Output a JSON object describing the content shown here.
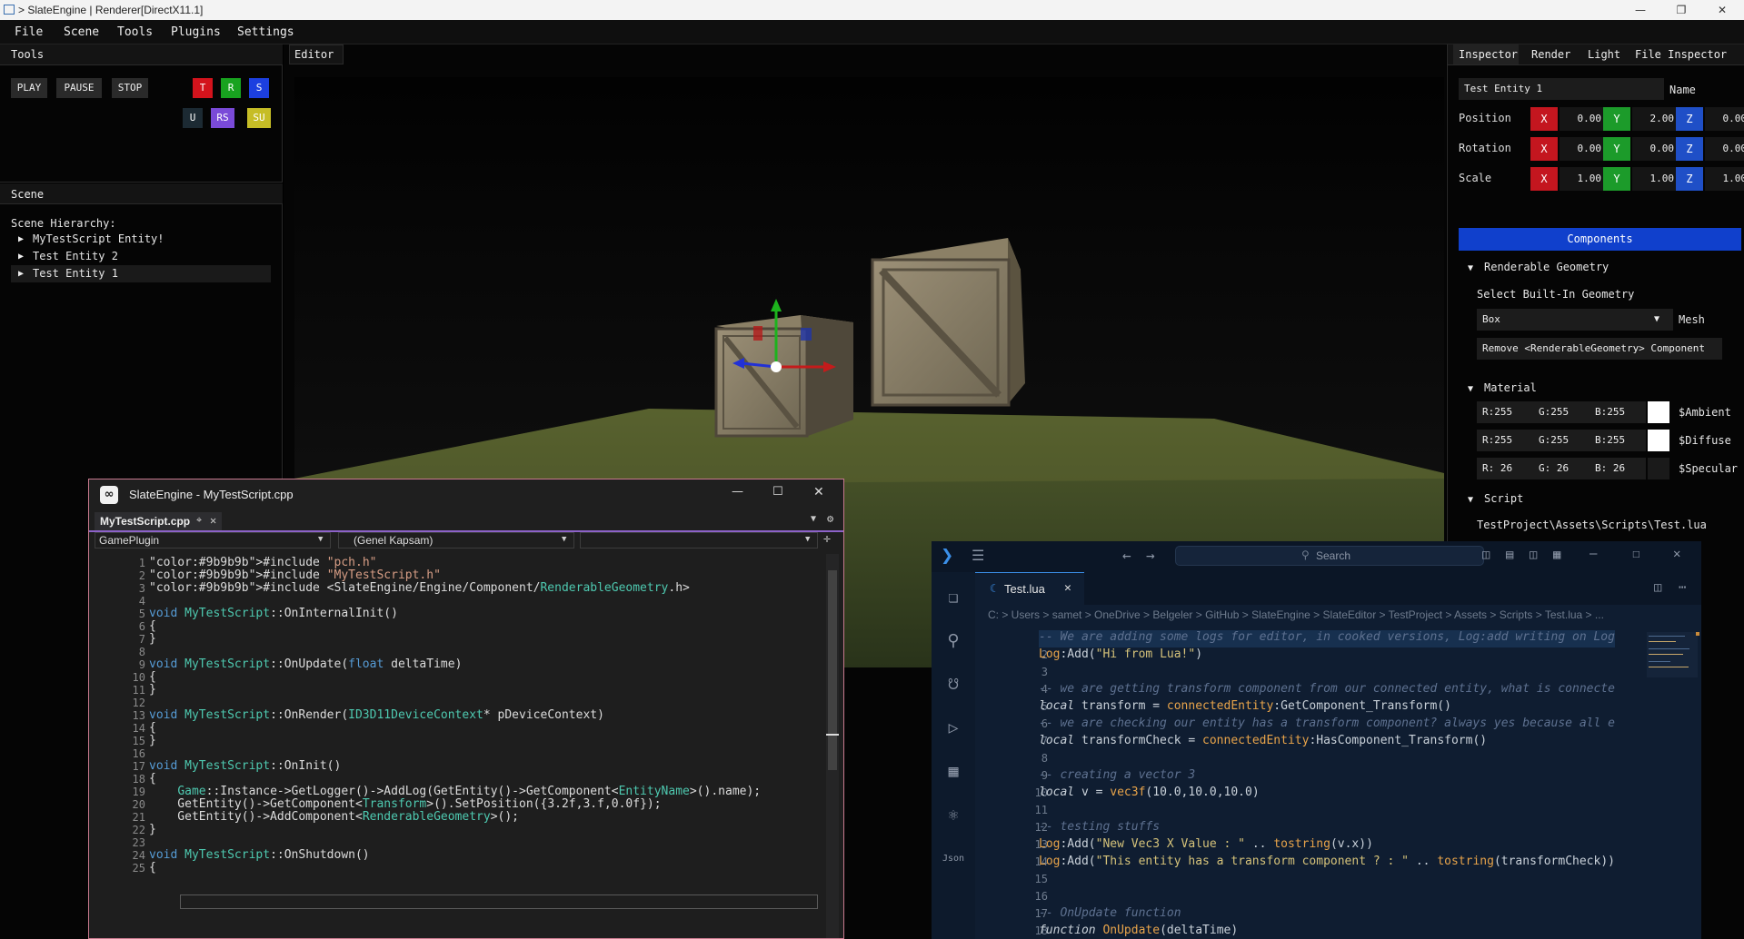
{
  "window": {
    "title": "> SlateEngine | Renderer[DirectX11.1]"
  },
  "menu": [
    "File",
    "Scene",
    "Tools",
    "Plugins",
    "Settings"
  ],
  "tools_panel": {
    "title": "Tools",
    "play": "PLAY",
    "pause": "PAUSE",
    "stop": "STOP",
    "gizmo_buttons": [
      {
        "label": "T",
        "color": "#d3131c"
      },
      {
        "label": "R",
        "color": "#18a31f"
      },
      {
        "label": "S",
        "color": "#1c3fe0"
      },
      {
        "label": "U",
        "color": "#1c2a33"
      },
      {
        "label": "RS",
        "color": "#7a4ad8"
      },
      {
        "label": "SU",
        "color": "#c6bd26"
      }
    ]
  },
  "scene_panel": {
    "title": "Scene",
    "hierarchy_label": "Scene Hierarchy:",
    "items": [
      "MyTestScript Entity!",
      "Test Entity 2",
      "Test Entity 1"
    ]
  },
  "editor": {
    "tab": "Editor"
  },
  "inspector": {
    "tabs": [
      "Inspector",
      "Render",
      "Light",
      "File Inspector"
    ],
    "entity_name": "Test Entity 1",
    "name_label": "Name",
    "transform": [
      {
        "label": "Position",
        "x": "0.00",
        "y": "2.00",
        "z": "0.00"
      },
      {
        "label": "Rotation",
        "x": "0.00",
        "y": "0.00",
        "z": "0.00"
      },
      {
        "label": "Scale",
        "x": "1.00",
        "y": "1.00",
        "z": "1.00"
      }
    ],
    "axis_labels": {
      "x": "X",
      "y": "Y",
      "z": "Z"
    },
    "components_button": "Components",
    "renderable": {
      "header": "Renderable Geometry",
      "select_label": "Select Built-In Geometry",
      "geometry_value": "Box",
      "mesh_label": "Mesh",
      "remove_button": "Remove <RenderableGeometry> Component"
    },
    "material": {
      "header": "Material",
      "rows": [
        {
          "r": "R:255",
          "g": "G:255",
          "b": "B:255",
          "swatch": "#ffffff",
          "label": "$Ambient"
        },
        {
          "r": "R:255",
          "g": "G:255",
          "b": "B:255",
          "swatch": "#ffffff",
          "label": "$Diffuse"
        },
        {
          "r": "R: 26",
          "g": "G: 26",
          "b": "B: 26",
          "swatch": "#1a1a1a",
          "label": "$Specular"
        }
      ]
    },
    "script": {
      "header": "Script",
      "path": "TestProject\\Assets\\Scripts\\Test.lua"
    }
  },
  "vs": {
    "title": "SlateEngine - MyTestScript.cpp",
    "file_tab": "MyTestScript.cpp",
    "project_dropdown": "GamePlugin",
    "scope_dropdown": "(Genel Kapsam)",
    "lines": [
      {
        "n": "1",
        "t": "#include \"pch.h\""
      },
      {
        "n": "2",
        "t": "#include \"MyTestScript.h\""
      },
      {
        "n": "3",
        "t": "#include <SlateEngine/Engine/Component/RenderableGeometry.h>"
      },
      {
        "n": "4",
        "t": ""
      },
      {
        "n": "5",
        "t": "void MyTestScript::OnInternalInit()"
      },
      {
        "n": "6",
        "t": "{"
      },
      {
        "n": "7",
        "t": "}"
      },
      {
        "n": "8",
        "t": ""
      },
      {
        "n": "9",
        "t": "void MyTestScript::OnUpdate(float deltaTime)"
      },
      {
        "n": "10",
        "t": "{"
      },
      {
        "n": "11",
        "t": "}"
      },
      {
        "n": "12",
        "t": ""
      },
      {
        "n": "13",
        "t": "void MyTestScript::OnRender(ID3D11DeviceContext* pDeviceContext)"
      },
      {
        "n": "14",
        "t": "{"
      },
      {
        "n": "15",
        "t": "}"
      },
      {
        "n": "16",
        "t": ""
      },
      {
        "n": "17",
        "t": "void MyTestScript::OnInit()"
      },
      {
        "n": "18",
        "t": "{"
      },
      {
        "n": "19",
        "t": "    Game::Instance->GetLogger()->AddLog(GetEntity()->GetComponent<EntityName>().name);"
      },
      {
        "n": "20",
        "t": "    GetEntity()->GetComponent<Transform>().SetPosition({3.2f,3.f,0.0f});"
      },
      {
        "n": "21",
        "t": "    GetEntity()->AddComponent<RenderableGeometry>();"
      },
      {
        "n": "22",
        "t": "}"
      },
      {
        "n": "23",
        "t": ""
      },
      {
        "n": "24",
        "t": "void MyTestScript::OnShutdown()"
      },
      {
        "n": "25",
        "t": "{"
      }
    ]
  },
  "vscode": {
    "search": "Search",
    "tab": "Test.lua",
    "breadcrumb": "C: > Users > samet > OneDrive > Belgeler > GitHub > SlateEngine > SlateEditor > TestProject > Assets > Scripts > Test.lua > ...",
    "lines": [
      {
        "n": "1",
        "t": "-- We are adding some logs for editor, in cooked versions, Log:add writing on Log"
      },
      {
        "n": "2",
        "t": "Log:Add(\"Hi from Lua!\")"
      },
      {
        "n": "3",
        "t": ""
      },
      {
        "n": "4",
        "t": "-- we are getting transform component from our connected entity, what is connecte"
      },
      {
        "n": "5",
        "t": "local transform = connectedEntity:GetComponent_Transform()"
      },
      {
        "n": "6",
        "t": "-- we are checking our entity has a transform component? always yes because all e"
      },
      {
        "n": "7",
        "t": "local transformCheck = connectedEntity:HasComponent_Transform()"
      },
      {
        "n": "8",
        "t": ""
      },
      {
        "n": "9",
        "t": "-- creating a vector 3"
      },
      {
        "n": "10",
        "t": "local v = vec3f(10.0,10.0,10.0)"
      },
      {
        "n": "11",
        "t": ""
      },
      {
        "n": "12",
        "t": "-- testing stuffs"
      },
      {
        "n": "13",
        "t": "Log:Add(\"New Vec3 X Value : \" .. tostring(v.x))"
      },
      {
        "n": "14",
        "t": "Log:Add(\"This entity has a transform component ? : \" .. tostring(transformCheck))"
      },
      {
        "n": "15",
        "t": ""
      },
      {
        "n": "16",
        "t": ""
      },
      {
        "n": "17",
        "t": "-- OnUpdate function"
      },
      {
        "n": "18",
        "t": "function OnUpdate(deltaTime)"
      }
    ]
  }
}
